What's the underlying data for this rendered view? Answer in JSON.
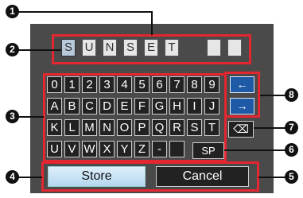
{
  "name_cells": [
    "S",
    "U",
    "N",
    "S",
    "E",
    "T",
    "",
    ""
  ],
  "keyboard": {
    "row1": [
      "0",
      "1",
      "2",
      "3",
      "4",
      "5",
      "6",
      "7",
      "8",
      "9"
    ],
    "row2": [
      "A",
      "B",
      "C",
      "D",
      "E",
      "F",
      "G",
      "H",
      "I",
      "J"
    ],
    "row3": [
      "K",
      "L",
      "M",
      "N",
      "O",
      "P",
      "Q",
      "R",
      "S",
      "T"
    ],
    "row4": [
      "U",
      "V",
      "W",
      "X",
      "Y",
      "Z",
      "-"
    ],
    "left_arrow": "←",
    "right_arrow": "→",
    "backspace": "⌫",
    "space": "SP"
  },
  "buttons": {
    "store": "Store",
    "cancel": "Cancel"
  },
  "callouts": [
    "1",
    "2",
    "3",
    "4",
    "5",
    "6",
    "7",
    "8"
  ],
  "colors": {
    "highlight": "#e3262f",
    "panel": "#4a4a4a",
    "selected_button": "#cfe6f7"
  }
}
